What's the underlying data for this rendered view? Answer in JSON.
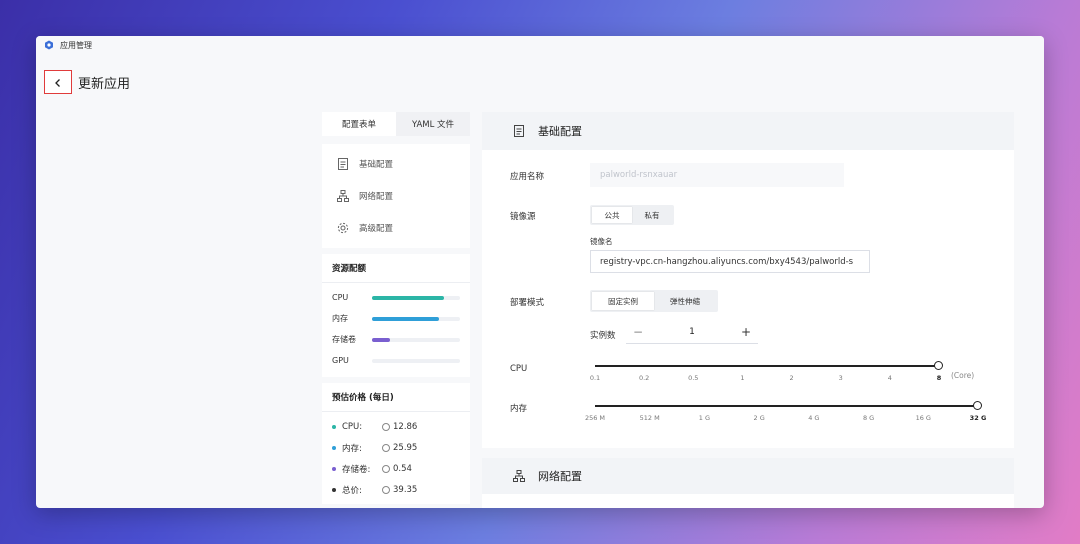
{
  "window": {
    "title": "应用管理"
  },
  "header": {
    "title": "更新应用"
  },
  "tabs": [
    {
      "label": "配置表单"
    },
    {
      "label": "YAML 文件"
    }
  ],
  "nav": [
    {
      "label": "基础配置",
      "icon": "document-icon"
    },
    {
      "label": "网络配置",
      "icon": "network-icon"
    },
    {
      "label": "高级配置",
      "icon": "gear-icon"
    }
  ],
  "resources": {
    "title": "资源配额",
    "items": [
      {
        "label": "CPU",
        "fill": 0.82,
        "color": "#2bb5a6"
      },
      {
        "label": "内存",
        "fill": 0.76,
        "color": "#2f9fd8"
      },
      {
        "label": "存储卷",
        "fill": 0.2,
        "color": "#7a5fd0"
      },
      {
        "label": "GPU",
        "fill": 0,
        "color": "#cccccc"
      }
    ]
  },
  "pricing": {
    "title": "预估价格 (每日)",
    "items": [
      {
        "label": "CPU:",
        "value": "12.86",
        "color": "#2bb5a6"
      },
      {
        "label": "内存:",
        "value": "25.95",
        "color": "#2f9fd8"
      },
      {
        "label": "存储卷:",
        "value": "0.54",
        "color": "#7a5fd0"
      },
      {
        "label": "总价:",
        "value": "39.35",
        "color": "#333333"
      }
    ]
  },
  "basic": {
    "title": "基础配置",
    "app_name_label": "应用名称",
    "app_name_value": "palworld-rsnxauar",
    "image_source_label": "镜像源",
    "image_source_options": [
      "公共",
      "私有"
    ],
    "image_source_selected": "公共",
    "image_name_label": "镜像名",
    "image_name_value": "registry-vpc.cn-hangzhou.aliyuncs.com/bxy4543/palworld-s",
    "deploy_mode_label": "部署模式",
    "deploy_mode_options": [
      "固定实例",
      "弹性伸缩"
    ],
    "deploy_mode_selected": "固定实例",
    "instances_label": "实例数",
    "instances_value": "1",
    "minus": "−",
    "plus": "+",
    "cpu": {
      "label": "CPU",
      "ticks": [
        "0.1",
        "0.2",
        "0.5",
        "1",
        "2",
        "3",
        "4",
        "8"
      ],
      "selected": "8",
      "unit": "(Core)"
    },
    "memory": {
      "label": "内存",
      "ticks": [
        "256 M",
        "512 M",
        "1 G",
        "2 G",
        "4 G",
        "8 G",
        "16 G",
        "32 G"
      ],
      "selected": "32 G"
    }
  },
  "network": {
    "title": "网络配置"
  }
}
